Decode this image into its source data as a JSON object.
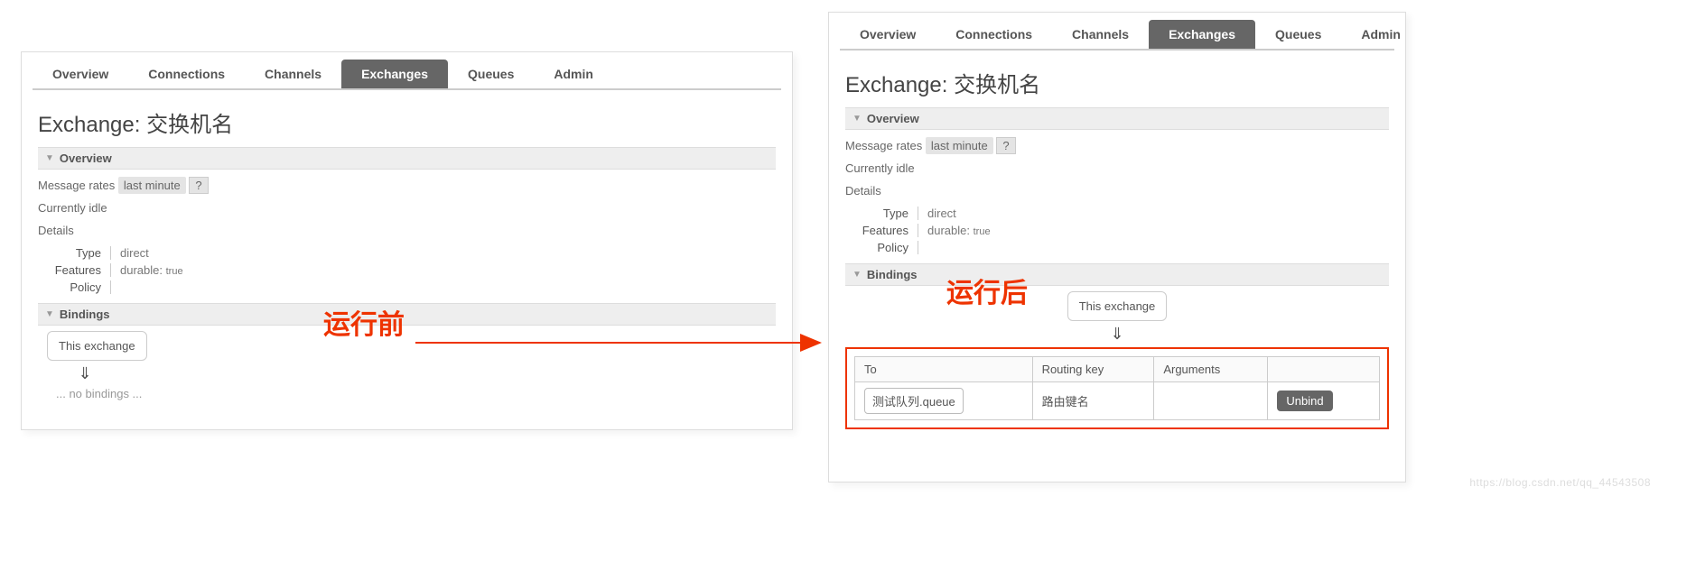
{
  "tabs": {
    "overview": "Overview",
    "connections": "Connections",
    "channels": "Channels",
    "exchanges": "Exchanges",
    "queues": "Queues",
    "admin": "Admin"
  },
  "page_title_prefix": "Exchange: ",
  "exchange_name": "交换机名",
  "sections": {
    "overview": "Overview",
    "bindings": "Bindings"
  },
  "message_rates_label": "Message rates",
  "last_minute": "last minute",
  "help": "?",
  "currently_idle": "Currently idle",
  "details_label": "Details",
  "details": {
    "type_label": "Type",
    "type_value": "direct",
    "features_label": "Features",
    "features_key": "durable:",
    "features_val": "true",
    "policy_label": "Policy"
  },
  "this_exchange": "This exchange",
  "down_arrow": "⇓",
  "no_bindings": "... no bindings ...",
  "bind_table": {
    "to": "To",
    "routing_key": "Routing key",
    "arguments": "Arguments",
    "queue": "测试队列.queue",
    "rk": "路由键名",
    "unbind": "Unbind"
  },
  "annotation_before": "运行前",
  "annotation_after": "运行后",
  "watermark": "https://blog.csdn.net/qq_44543508"
}
